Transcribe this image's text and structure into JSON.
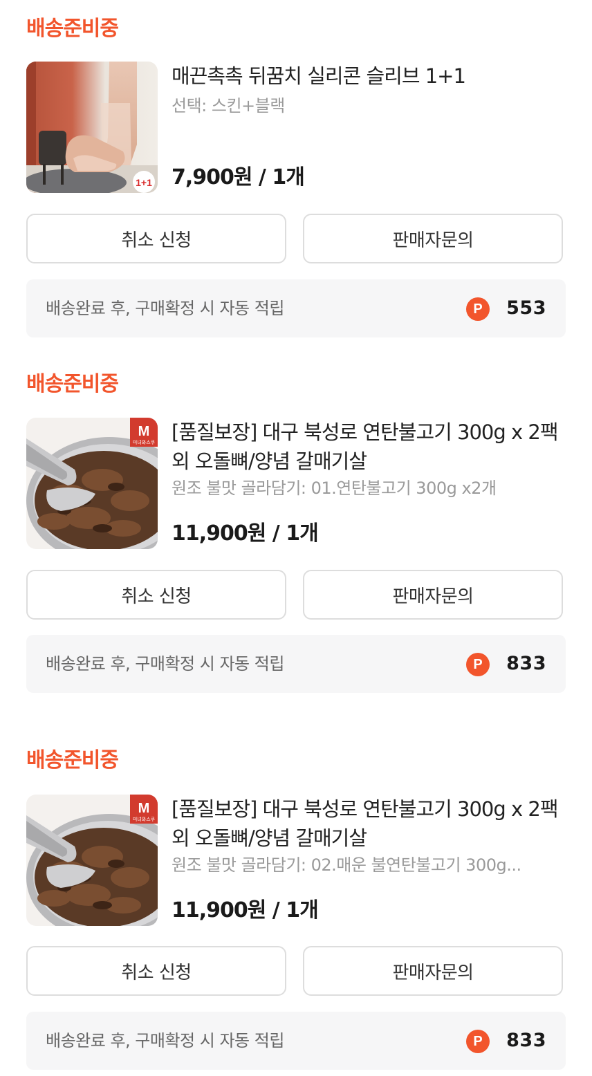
{
  "orders": [
    {
      "status": "배송준비중",
      "title": "매끈촉촉 뒤꿈치 실리콘 슬리브 1+1",
      "option": "선택: 스킨+블랙",
      "price": "7,900원 / 1개",
      "thumb_badge": "1+1",
      "cancel_label": "취소 신청",
      "inquiry_label": "판매자문의",
      "points_text": "배송완료 후, 구매확정 시 자동 적립",
      "points_icon": "P",
      "points_value": "553"
    },
    {
      "status": "배송준비중",
      "title": "[품질보장] 대구 북성로 연탄불고기 300g x 2팩 외 오돌뼈/양념 갈매기살",
      "option": "원조 불맛 골라담기: 01.연탄불고기 300g x2개",
      "price": "11,900원 / 1개",
      "thumb_brand": "M",
      "thumb_brand_sub": "미녀와스쿠",
      "cancel_label": "취소 신청",
      "inquiry_label": "판매자문의",
      "points_text": "배송완료 후, 구매확정 시 자동 적립",
      "points_icon": "P",
      "points_value": "833"
    },
    {
      "status": "배송준비중",
      "title": "[품질보장] 대구 북성로 연탄불고기 300g x 2팩 외 오돌뼈/양념 갈매기살",
      "option": "원조 불맛 골라담기: 02.매운 불연탄불고기 300g...",
      "price": "11,900원 / 1개",
      "thumb_brand": "M",
      "thumb_brand_sub": "미녀와스쿠",
      "cancel_label": "취소 신청",
      "inquiry_label": "판매자문의",
      "points_text": "배송완료 후, 구매확정 시 자동 적립",
      "points_icon": "P",
      "points_value": "833"
    }
  ],
  "colors": {
    "status": "#f2552c",
    "points_badge": "#f2552c",
    "points_bg": "#f6f6f7",
    "button_border": "#dddddd"
  },
  "icons": {
    "points": "points-coin-icon"
  }
}
